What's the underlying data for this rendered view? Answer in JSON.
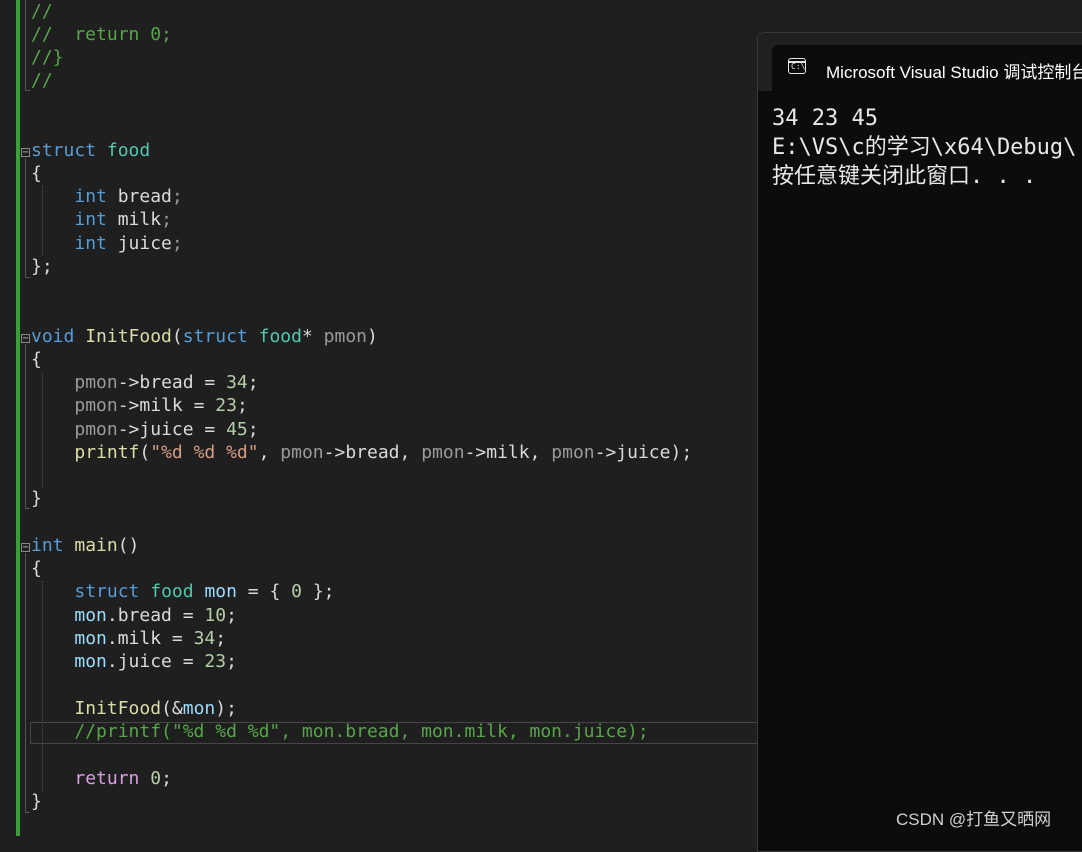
{
  "editor": {
    "lines": [
      {
        "id": "l01",
        "segs": [
          {
            "c": "cm",
            "t": "//"
          }
        ]
      },
      {
        "id": "l02",
        "segs": [
          {
            "c": "cm",
            "t": "//  return 0;"
          }
        ]
      },
      {
        "id": "l03",
        "segs": [
          {
            "c": "cm",
            "t": "//}"
          }
        ]
      },
      {
        "id": "l04",
        "segs": [
          {
            "c": "cm",
            "t": "//"
          }
        ]
      },
      {
        "id": "l05",
        "segs": [
          {
            "c": "kw",
            "t": "struct"
          },
          {
            "c": "",
            "t": " "
          },
          {
            "c": "ty",
            "t": "food"
          }
        ]
      },
      {
        "id": "l06",
        "segs": [
          {
            "c": "",
            "t": "{"
          }
        ]
      },
      {
        "id": "l07",
        "segs": [
          {
            "c": "",
            "t": "    "
          },
          {
            "c": "kw",
            "t": "int"
          },
          {
            "c": "",
            "t": " bread"
          },
          {
            "c": "par",
            "t": ";"
          }
        ]
      },
      {
        "id": "l08",
        "segs": [
          {
            "c": "",
            "t": "    "
          },
          {
            "c": "kw",
            "t": "int"
          },
          {
            "c": "",
            "t": " milk"
          },
          {
            "c": "par",
            "t": ";"
          }
        ]
      },
      {
        "id": "l09",
        "segs": [
          {
            "c": "",
            "t": "    "
          },
          {
            "c": "kw",
            "t": "int"
          },
          {
            "c": "",
            "t": " juice"
          },
          {
            "c": "par",
            "t": ";"
          }
        ]
      },
      {
        "id": "l10",
        "segs": [
          {
            "c": "",
            "t": "};"
          }
        ]
      },
      {
        "id": "l11",
        "segs": [
          {
            "c": "kw",
            "t": "void"
          },
          {
            "c": "",
            "t": " "
          },
          {
            "c": "fn",
            "t": "InitFood"
          },
          {
            "c": "",
            "t": "("
          },
          {
            "c": "kw",
            "t": "struct"
          },
          {
            "c": "",
            "t": " "
          },
          {
            "c": "ty",
            "t": "food"
          },
          {
            "c": "",
            "t": "* "
          },
          {
            "c": "par",
            "t": "pmon"
          },
          {
            "c": "",
            "t": ")"
          }
        ]
      },
      {
        "id": "l12",
        "segs": [
          {
            "c": "",
            "t": "{"
          }
        ]
      },
      {
        "id": "l13",
        "segs": [
          {
            "c": "",
            "t": "    "
          },
          {
            "c": "par",
            "t": "pmon"
          },
          {
            "c": "",
            "t": "->bread = "
          },
          {
            "c": "num",
            "t": "34"
          },
          {
            "c": "",
            "t": ";"
          }
        ]
      },
      {
        "id": "l14",
        "segs": [
          {
            "c": "",
            "t": "    "
          },
          {
            "c": "par",
            "t": "pmon"
          },
          {
            "c": "",
            "t": "->milk = "
          },
          {
            "c": "num",
            "t": "23"
          },
          {
            "c": "",
            "t": ";"
          }
        ]
      },
      {
        "id": "l15",
        "segs": [
          {
            "c": "",
            "t": "    "
          },
          {
            "c": "par",
            "t": "pmon"
          },
          {
            "c": "",
            "t": "->juice = "
          },
          {
            "c": "num",
            "t": "45"
          },
          {
            "c": "",
            "t": ";"
          }
        ]
      },
      {
        "id": "l16",
        "segs": [
          {
            "c": "",
            "t": "    "
          },
          {
            "c": "fn",
            "t": "printf"
          },
          {
            "c": "",
            "t": "("
          },
          {
            "c": "str",
            "t": "\"%d %d %d\""
          },
          {
            "c": "",
            "t": ", "
          },
          {
            "c": "par",
            "t": "pmon"
          },
          {
            "c": "",
            "t": "->bread, "
          },
          {
            "c": "par",
            "t": "pmon"
          },
          {
            "c": "",
            "t": "->milk, "
          },
          {
            "c": "par",
            "t": "pmon"
          },
          {
            "c": "",
            "t": "->juice);"
          }
        ]
      },
      {
        "id": "l17",
        "segs": [
          {
            "c": "",
            "t": ""
          }
        ]
      },
      {
        "id": "l18",
        "segs": [
          {
            "c": "",
            "t": "}"
          }
        ]
      },
      {
        "id": "l19",
        "segs": [
          {
            "c": "kw",
            "t": "int"
          },
          {
            "c": "",
            "t": " "
          },
          {
            "c": "fn",
            "t": "main"
          },
          {
            "c": "",
            "t": "()"
          }
        ]
      },
      {
        "id": "l20",
        "segs": [
          {
            "c": "",
            "t": "{"
          }
        ]
      },
      {
        "id": "l21",
        "segs": [
          {
            "c": "",
            "t": "    "
          },
          {
            "c": "kw",
            "t": "struct"
          },
          {
            "c": "",
            "t": " "
          },
          {
            "c": "ty",
            "t": "food"
          },
          {
            "c": "",
            "t": " "
          },
          {
            "c": "var",
            "t": "mon"
          },
          {
            "c": "",
            "t": " = { "
          },
          {
            "c": "num",
            "t": "0"
          },
          {
            "c": "",
            "t": " };"
          }
        ]
      },
      {
        "id": "l22",
        "segs": [
          {
            "c": "",
            "t": "    "
          },
          {
            "c": "var",
            "t": "mon"
          },
          {
            "c": "",
            "t": ".bread = "
          },
          {
            "c": "num",
            "t": "10"
          },
          {
            "c": "",
            "t": ";"
          }
        ]
      },
      {
        "id": "l23",
        "segs": [
          {
            "c": "",
            "t": "    "
          },
          {
            "c": "var",
            "t": "mon"
          },
          {
            "c": "",
            "t": ".milk = "
          },
          {
            "c": "num",
            "t": "34"
          },
          {
            "c": "",
            "t": ";"
          }
        ]
      },
      {
        "id": "l24",
        "segs": [
          {
            "c": "",
            "t": "    "
          },
          {
            "c": "var",
            "t": "mon"
          },
          {
            "c": "",
            "t": ".juice = "
          },
          {
            "c": "num",
            "t": "23"
          },
          {
            "c": "",
            "t": ";"
          }
        ]
      },
      {
        "id": "l25",
        "segs": [
          {
            "c": "",
            "t": ""
          }
        ]
      },
      {
        "id": "l26",
        "segs": [
          {
            "c": "",
            "t": "    "
          },
          {
            "c": "fn",
            "t": "InitFood"
          },
          {
            "c": "",
            "t": "(&"
          },
          {
            "c": "var",
            "t": "mon"
          },
          {
            "c": "",
            "t": ");"
          }
        ]
      },
      {
        "id": "l27",
        "segs": [
          {
            "c": "cm",
            "t": "    //printf(\"%d %d %d\", mon.bread, mon.milk, mon.juice);"
          }
        ]
      },
      {
        "id": "l28",
        "segs": [
          {
            "c": "",
            "t": ""
          }
        ]
      },
      {
        "id": "l29",
        "segs": [
          {
            "c": "",
            "t": "    "
          },
          {
            "c": "ctl",
            "t": "return"
          },
          {
            "c": "",
            "t": " "
          },
          {
            "c": "num",
            "t": "0"
          },
          {
            "c": "",
            "t": ";"
          }
        ]
      },
      {
        "id": "l30",
        "segs": [
          {
            "c": "",
            "t": "}"
          }
        ]
      }
    ]
  },
  "console": {
    "title": "Microsoft Visual Studio 调试控制台",
    "icon": "console-icon",
    "icon_glyph": "C:\\",
    "output": [
      "34 23 45",
      "E:\\VS\\c的学习\\x64\\Debug\\",
      "按任意键关闭此窗口. . ."
    ]
  },
  "watermark": "CSDN @打鱼又晒网",
  "colors": {
    "background": "#1f1f1f",
    "keyword": "#569cd6",
    "type": "#4ec9b0",
    "function": "#dcdcaa",
    "comment": "#57a64a",
    "number": "#b5cea8",
    "string": "#d69d85",
    "change_bar": "#3c9d3c"
  }
}
